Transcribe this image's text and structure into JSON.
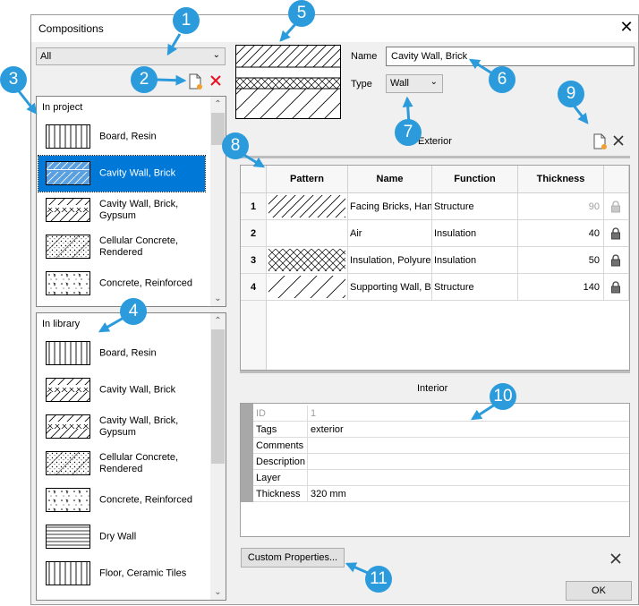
{
  "window": {
    "title": "Compositions",
    "close_glyph": "✕"
  },
  "filter": {
    "selected": "All"
  },
  "project_list": {
    "header": "In project",
    "items": [
      {
        "label": "Board, Resin",
        "pattern": "vertical-lines"
      },
      {
        "label": "Cavity Wall, Brick",
        "pattern": "cavity",
        "selected": true
      },
      {
        "label": "Cavity Wall, Brick, Gypsum",
        "pattern": "cavity"
      },
      {
        "label": "Cellular Concrete, Rendered",
        "pattern": "dots"
      },
      {
        "label": "Concrete, Reinforced",
        "pattern": "concrete"
      }
    ]
  },
  "library_list": {
    "header": "In library",
    "items": [
      {
        "label": "Board, Resin",
        "pattern": "vertical-lines"
      },
      {
        "label": "Cavity Wall, Brick",
        "pattern": "cavity"
      },
      {
        "label": "Cavity Wall, Brick, Gypsum",
        "pattern": "cavity"
      },
      {
        "label": "Cellular Concrete, Rendered",
        "pattern": "dots"
      },
      {
        "label": "Concrete, Reinforced",
        "pattern": "concrete"
      },
      {
        "label": "Dry Wall",
        "pattern": "horizontal-lines"
      },
      {
        "label": "Floor, Ceramic Tiles",
        "pattern": "vertical-lines"
      }
    ]
  },
  "composition": {
    "name_label": "Name",
    "name_value": "Cavity Wall, Brick",
    "type_label": "Type",
    "type_value": "Wall"
  },
  "layers": {
    "exterior_label": "Exterior",
    "interior_label": "Interior",
    "columns": [
      "Pattern",
      "Name",
      "Function",
      "Thickness"
    ],
    "rows": [
      {
        "index": "1",
        "pattern": "diagonal",
        "name": "Facing Bricks, Hand",
        "function": "Structure",
        "thickness": "90",
        "locked": true,
        "greyed": true
      },
      {
        "index": "2",
        "pattern": "none",
        "name": "Air",
        "function": "Insulation",
        "thickness": "40",
        "locked": true,
        "greyed": false
      },
      {
        "index": "3",
        "pattern": "crosshatch",
        "name": "Insulation, Polyure",
        "function": "Insulation",
        "thickness": "50",
        "locked": true,
        "greyed": false
      },
      {
        "index": "4",
        "pattern": "diagonal-wide",
        "name": "Supporting Wall, Br",
        "function": "Structure",
        "thickness": "140",
        "locked": true,
        "greyed": false
      }
    ]
  },
  "properties": {
    "rows": [
      {
        "label": "ID",
        "value": "1",
        "greyed": true
      },
      {
        "label": "Tags",
        "value": "exterior"
      },
      {
        "label": "Comments",
        "value": ""
      },
      {
        "label": "Description",
        "value": ""
      },
      {
        "label": "Layer",
        "value": ""
      },
      {
        "label": "Thickness",
        "value": "320 mm"
      }
    ]
  },
  "buttons": {
    "custom_properties": "Custom Properties...",
    "ok": "OK"
  },
  "callouts": [
    "1",
    "2",
    "3",
    "4",
    "5",
    "6",
    "7",
    "8",
    "9",
    "10",
    "11"
  ],
  "colors": {
    "selection": "#0078d7",
    "callout": "#2b9bdc",
    "delete_red": "#e81123"
  },
  "icons": [
    "new-composition-icon",
    "delete-composition-icon",
    "new-layer-icon",
    "delete-layer-icon",
    "lock-icon",
    "dropdown-arrow-icon"
  ]
}
